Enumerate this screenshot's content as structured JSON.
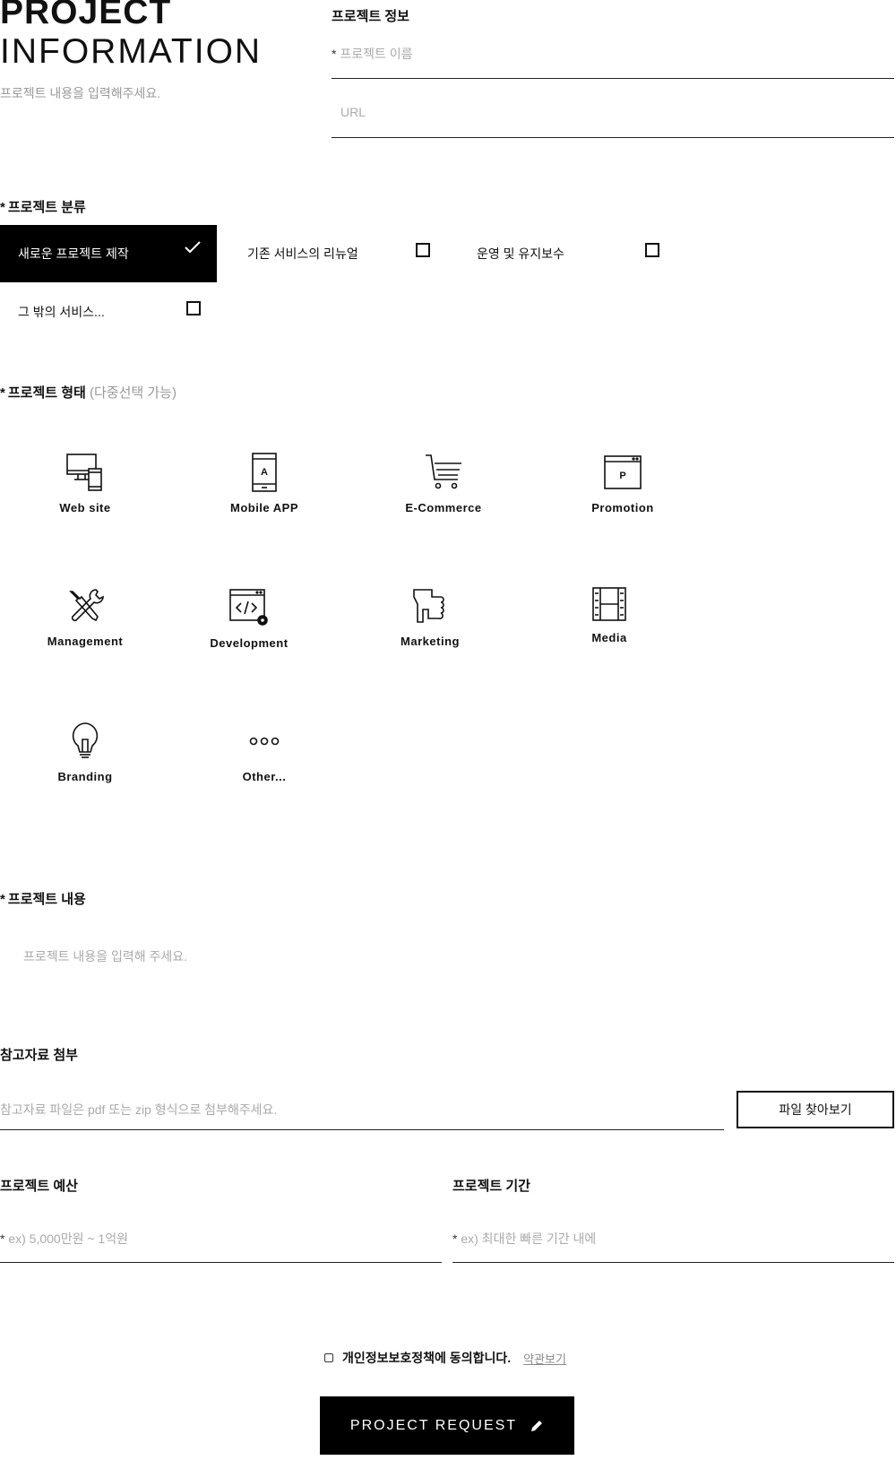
{
  "header": {
    "title_line1": "PROJECT",
    "title_line2": "INFORMATION",
    "subtitle": "프로젝트 내용을 입력해주세요."
  },
  "info": {
    "label": "프로젝트 정보",
    "name_required_mark": "*",
    "name_placeholder": "프로젝트 이름",
    "url_placeholder": "URL"
  },
  "category": {
    "label": "프로젝트 분류",
    "required_mark": "*",
    "options": [
      {
        "label": "새로운 프로젝트 제작",
        "selected": true
      },
      {
        "label": "기존 서비스의 리뉴얼",
        "selected": false
      },
      {
        "label": "운영 및 유지보수",
        "selected": false
      },
      {
        "label": "그 밖의 서비스...",
        "selected": false
      }
    ]
  },
  "type": {
    "label": "프로젝트 형태",
    "note": "(다중선택 가능)",
    "required_mark": "*",
    "items": [
      {
        "label": "Web site",
        "icon": "monitor-phone-icon"
      },
      {
        "label": "Mobile APP",
        "icon": "mobile-icon"
      },
      {
        "label": "E-Commerce",
        "icon": "cart-icon"
      },
      {
        "label": "Promotion",
        "icon": "promotion-window-icon"
      },
      {
        "label": "Management",
        "icon": "tools-icon"
      },
      {
        "label": "Development",
        "icon": "code-window-icon"
      },
      {
        "label": "Marketing",
        "icon": "thumbs-up-icon"
      },
      {
        "label": "Media",
        "icon": "film-icon"
      },
      {
        "label": "Branding",
        "icon": "lightbulb-icon"
      },
      {
        "label": "Other...",
        "icon": "dots-icon"
      }
    ]
  },
  "content": {
    "label": "프로젝트 내용",
    "required_mark": "*",
    "placeholder": "프로젝트 내용을 입력해 주세요."
  },
  "attachment": {
    "label": "참고자료 첨부",
    "placeholder": "참고자료 파일은 pdf 또는 zip 형식으로 첨부해주세요.",
    "button": "파일 찾아보기"
  },
  "budget": {
    "label": "프로젝트 예산",
    "required_mark": "*",
    "placeholder": "ex) 5,000만원 ~ 1억원"
  },
  "period": {
    "label": "프로젝트 기간",
    "required_mark": "*",
    "placeholder": "ex) 최대한 빠른 기간 내에"
  },
  "agree": {
    "text": "개인정보보호정책에 동의합니다.",
    "link": "약관보기"
  },
  "submit": {
    "label": "PROJECT REQUEST",
    "icon": "pencil-icon"
  }
}
